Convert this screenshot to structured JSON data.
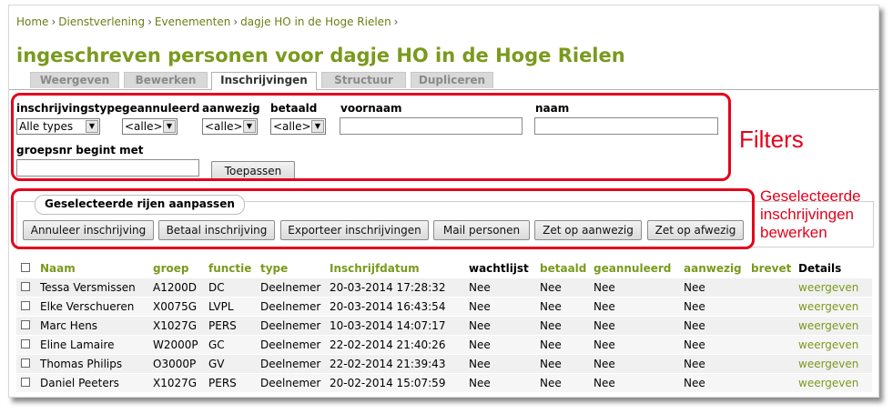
{
  "breadcrumb": [
    "Home",
    "Dienstverlening",
    "Evenementen",
    "dagje HO in de Hoge Rielen"
  ],
  "breadcrumb_separator": "›",
  "page_title": "ingeschreven personen voor dagje HO in de Hoge Rielen",
  "tabs": [
    {
      "label": "Weergeven",
      "active": false
    },
    {
      "label": "Bewerken",
      "active": false
    },
    {
      "label": "Inschrijvingen",
      "active": true
    },
    {
      "label": "Structuur",
      "active": false
    },
    {
      "label": "Dupliceren",
      "active": false
    }
  ],
  "filters": {
    "inschrijvingstype": {
      "label": "inschrijvingstype",
      "value": "Alle types"
    },
    "geannuleerd": {
      "label": "geannuleerd",
      "value": "<alle>"
    },
    "aanwezig": {
      "label": "aanwezig",
      "value": "<alle>"
    },
    "betaald": {
      "label": "betaald",
      "value": "<alle>"
    },
    "voornaam": {
      "label": "voornaam",
      "value": ""
    },
    "naam": {
      "label": "naam",
      "value": ""
    },
    "groepsnr": {
      "label": "groepsnr begint met",
      "value": ""
    },
    "apply_button": "Toepassen"
  },
  "bulk": {
    "legend": "Geselecteerde rijen aanpassen",
    "buttons": [
      "Annuleer inschrijving",
      "Betaal inschrijving",
      "Exporteer inschrijvingen",
      "Mail personen",
      "Zet op aanwezig",
      "Zet op afwezig"
    ]
  },
  "annotations": {
    "filters": "Filters",
    "bulk_line1": "Geselecteerde",
    "bulk_line2": "inschrijvingen",
    "bulk_line3": "bewerken",
    "color": "#e3001b"
  },
  "table": {
    "headers": [
      "Naam",
      "groep",
      "functie",
      "type",
      "Inschrijfdatum",
      "wachtlijst",
      "betaald",
      "geannuleerd",
      "aanwezig",
      "brevet",
      "Details"
    ],
    "rows": [
      [
        "Tessa Versmissen",
        "A1200D",
        "DC",
        "Deelnemer",
        "20-03-2014 17:28:32",
        "Nee",
        "Nee",
        "Nee",
        "Nee",
        "",
        "weergeven"
      ],
      [
        "Elke Verschueren",
        "X0075G",
        "LVPL",
        "Deelnemer",
        "20-03-2014 16:43:54",
        "Nee",
        "Nee",
        "Nee",
        "Nee",
        "",
        "weergeven"
      ],
      [
        "Marc Hens",
        "X1027G",
        "PERS",
        "Deelnemer",
        "10-03-2014 14:07:17",
        "Nee",
        "Nee",
        "Nee",
        "Nee",
        "",
        "weergeven"
      ],
      [
        "Eline Lamaire",
        "W2000P",
        "GC",
        "Deelnemer",
        "22-02-2014 21:40:26",
        "Nee",
        "Nee",
        "Nee",
        "Nee",
        "",
        "weergeven"
      ],
      [
        "Thomas Philips",
        "O3000P",
        "GV",
        "Deelnemer",
        "22-02-2014 21:39:43",
        "Nee",
        "Nee",
        "Nee",
        "Nee",
        "",
        "weergeven"
      ],
      [
        "Daniel Peeters",
        "X1027G",
        "PERS",
        "Deelnemer",
        "20-02-2014 15:07:59",
        "Nee",
        "Nee",
        "Nee",
        "Nee",
        "",
        "weergeven"
      ]
    ]
  },
  "colors": {
    "accent": "#7a9a1d",
    "link": "#6f7d17"
  }
}
